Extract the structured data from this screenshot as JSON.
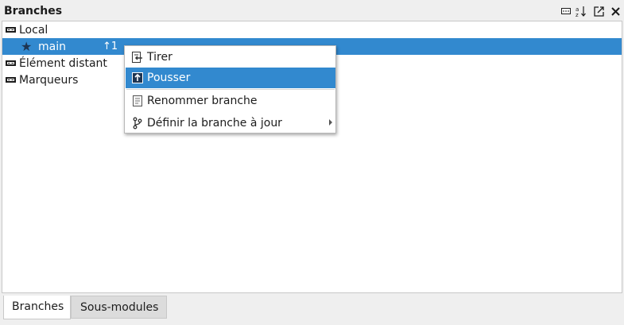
{
  "dock": {
    "title": "Branches",
    "buttons": [
      "collapse-icon",
      "sort-alpha-icon",
      "popout-icon",
      "close-icon"
    ]
  },
  "tree": {
    "local_label": "Local",
    "branch_main": {
      "label": "main",
      "ahead": "↑1"
    },
    "remote_label": "Élément distant",
    "tags_label": "Marqueurs"
  },
  "menu": {
    "items": [
      {
        "label": "Tirer",
        "icon": "pull-icon"
      },
      {
        "label": "Pousser",
        "icon": "push-icon"
      },
      {
        "label": "Renommer branche",
        "icon": "rename-icon"
      },
      {
        "label": "Définir la branche à jour",
        "icon": "branch-icon"
      }
    ]
  },
  "tabs": [
    {
      "label": "Branches",
      "active": true
    },
    {
      "label": "Sous-modules",
      "active": false
    }
  ],
  "colors": {
    "selection": "#3289cf",
    "background": "#efefef"
  }
}
